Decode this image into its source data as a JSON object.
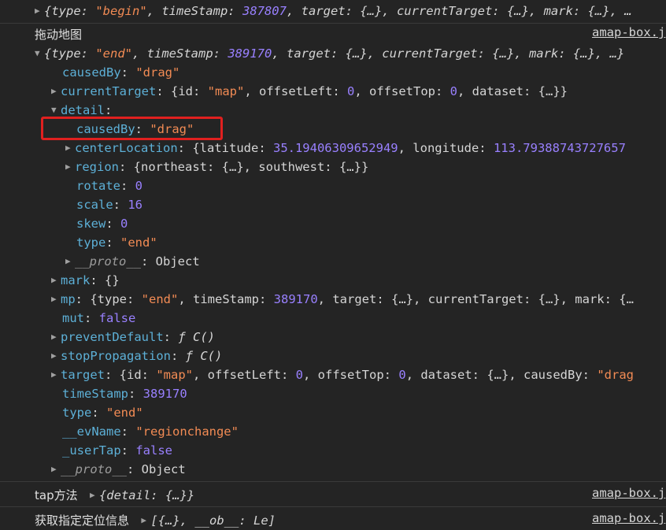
{
  "top_line": {
    "parts": [
      "{type: ",
      "\"begin\"",
      ", timeStamp: ",
      "387807",
      ", target: {…}, currentTarget: {…}, mark: {…}, …"
    ]
  },
  "group_label": "拖动地图",
  "source_link": "amap-box.j",
  "event_summary": {
    "open": "{type: ",
    "type_val": "\"end\"",
    "ts_key": ", timeStamp: ",
    "ts_val": "389170",
    "rest": ", target: {…}, currentTarget: {…}, mark: {…}, …}"
  },
  "props": {
    "causedBy_key": "causedBy",
    "causedBy_val": "\"drag\"",
    "currentTarget_key": "currentTarget",
    "currentTarget_val": "{id: \"map\", offsetLeft: 0, offsetTop: 0, dataset: {…}}",
    "ct_p1": "{id: ",
    "ct_p2": "\"map\"",
    "ct_p3": ", offsetLeft: ",
    "ct_p4": "0",
    "ct_p5": ", offsetTop: ",
    "ct_p6": "0",
    "ct_p7": ", dataset: {…}}",
    "detail_key": "detail",
    "detail": {
      "causedBy_key": "causedBy",
      "causedBy_val": "\"drag\"",
      "centerLocation_key": "centerLocation",
      "cl_p1": "{latitude: ",
      "cl_p2": "35.19406309652949",
      "cl_p3": ", longitude: ",
      "cl_p4": "113.79388743727657",
      "region_key": "region",
      "region_val": "{northeast: {…}, southwest: {…}}",
      "rotate_key": "rotate",
      "rotate_val": "0",
      "scale_key": "scale",
      "scale_val": "16",
      "skew_key": "skew",
      "skew_val": "0",
      "type_key": "type",
      "type_val": "\"end\"",
      "proto_key": "__proto__",
      "proto_val": "Object"
    },
    "mark_key": "mark",
    "mark_val": "{}",
    "mp_key": "mp",
    "mp_p1": "{type: ",
    "mp_p2": "\"end\"",
    "mp_p3": ", timeStamp: ",
    "mp_p4": "389170",
    "mp_p5": ", target: {…}, currentTarget: {…}, mark: {…",
    "mut_key": "mut",
    "mut_val": "false",
    "preventDefault_key": "preventDefault",
    "preventDefault_val": "ƒ C()",
    "stopPropagation_key": "stopPropagation",
    "stopPropagation_val": "ƒ C()",
    "target_key": "target",
    "tg_p1": "{id: ",
    "tg_p2": "\"map\"",
    "tg_p3": ", offsetLeft: ",
    "tg_p4": "0",
    "tg_p5": ", offsetTop: ",
    "tg_p6": "0",
    "tg_p7": ", dataset: {…}, causedBy: ",
    "tg_p8": "\"drag",
    "timeStamp_key": "timeStamp",
    "timeStamp_val": "389170",
    "type_key": "type",
    "type_val": "\"end\"",
    "evName_key": "__evName",
    "evName_val": "\"regionchange\"",
    "userTap_key": "_userTap",
    "userTap_val": "false",
    "proto_key": "__proto__",
    "proto_val": "Object"
  },
  "tap_msg": {
    "label": "tap方法",
    "value": "{detail: {…}}",
    "link": "amap-box.j"
  },
  "loc_msg": {
    "label": "获取指定定位信息",
    "value": "[{…},  __ob__: Le]",
    "link": "amap-box.j"
  },
  "colors": {
    "background": "#242424",
    "key": "#5db0d7",
    "string": "#f28b54",
    "number": "#9980ff",
    "highlight": "#e0201f"
  }
}
